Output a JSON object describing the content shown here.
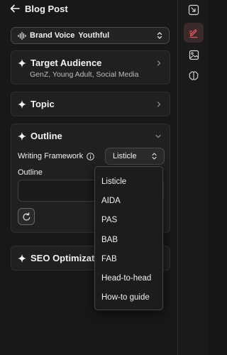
{
  "header": {
    "title": "Blog Post"
  },
  "brand_voice": {
    "label": "Brand Voice",
    "value": "Youthful"
  },
  "cards": {
    "target_audience": {
      "title": "Target Audience",
      "subtitle": "GenZ, Young Adult, Social Media"
    },
    "topic": {
      "title": "Topic"
    },
    "outline": {
      "title": "Outline",
      "framework_label": "Writing Framework",
      "framework_value": "Listicle",
      "outline_label": "Outline",
      "outline_value": ""
    },
    "seo": {
      "title": "SEO Optimization"
    }
  },
  "dropdown": {
    "options": [
      "Listicle",
      "AIDA",
      "PAS",
      "BAB",
      "FAB",
      "Head-to-head",
      "How-to guide"
    ]
  },
  "rail": {
    "icons": [
      "expand-image-icon",
      "edit-pen-icon",
      "image-icon",
      "brain-icon"
    ],
    "active": "edit-pen-icon",
    "active_color": "#e0565b"
  },
  "colors": {
    "background": "#181818",
    "card": "#202020",
    "border": "#2e2e2e",
    "accent": "#e0565b"
  }
}
